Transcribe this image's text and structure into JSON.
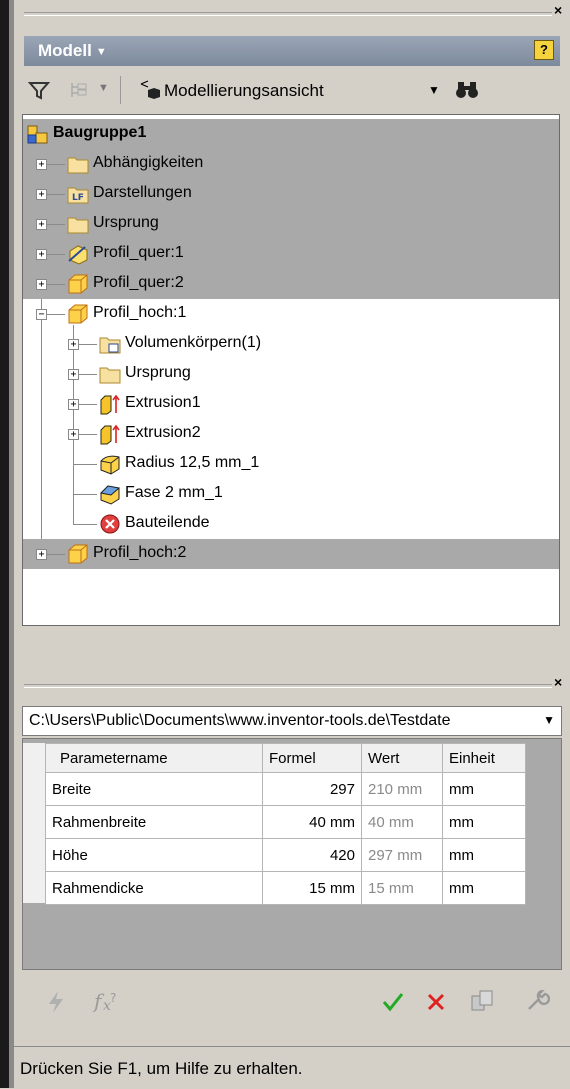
{
  "panel": {
    "title": "Modell",
    "help_label": "?"
  },
  "toolbar": {
    "view_label": "Modellierungsansicht"
  },
  "tree": {
    "root": "Baugruppe1",
    "items": [
      {
        "label": "Abhängigkeiten",
        "icon": "folder-icon"
      },
      {
        "label": "Darstellungen",
        "icon": "representations-icon"
      },
      {
        "label": "Ursprung",
        "icon": "folder-icon"
      },
      {
        "label": "Profil_quer:1",
        "icon": "part-adaptive-icon"
      },
      {
        "label": "Profil_quer:2",
        "icon": "part-icon"
      },
      {
        "label": "Profil_hoch:1",
        "icon": "part-icon"
      },
      {
        "label": "Volumenkörpern(1)",
        "icon": "solid-bodies-icon"
      },
      {
        "label": "Ursprung",
        "icon": "folder-icon"
      },
      {
        "label": "Extrusion1",
        "icon": "extrusion-icon"
      },
      {
        "label": "Extrusion2",
        "icon": "extrusion-icon"
      },
      {
        "label": "Radius 12,5 mm_1",
        "icon": "fillet-icon"
      },
      {
        "label": "Fase 2 mm_1",
        "icon": "chamfer-icon"
      },
      {
        "label": "Bauteilende",
        "icon": "end-of-part-icon"
      },
      {
        "label": "Profil_hoch:2",
        "icon": "part-icon"
      }
    ]
  },
  "params": {
    "path": "C:\\Users\\Public\\Documents\\www.inventor-tools.de\\Testdate",
    "headers": [
      "Parametername",
      "Formel",
      "Wert",
      "Einheit"
    ],
    "rows": [
      [
        "Breite",
        "297",
        "210 mm",
        "mm"
      ],
      [
        "Rahmenbreite",
        "40 mm",
        "40 mm",
        "mm"
      ],
      [
        "Höhe",
        "420",
        "297 mm",
        "mm"
      ],
      [
        "Rahmendicke",
        "15 mm",
        "15 mm",
        "mm"
      ]
    ]
  },
  "status": {
    "text": "Drücken Sie F1, um Hilfe zu erhalten."
  },
  "colors": {
    "header_bar": "#8a96a8",
    "selection": "#a9a9a9",
    "accept": "#22aa22",
    "cancel": "#dd2222"
  }
}
